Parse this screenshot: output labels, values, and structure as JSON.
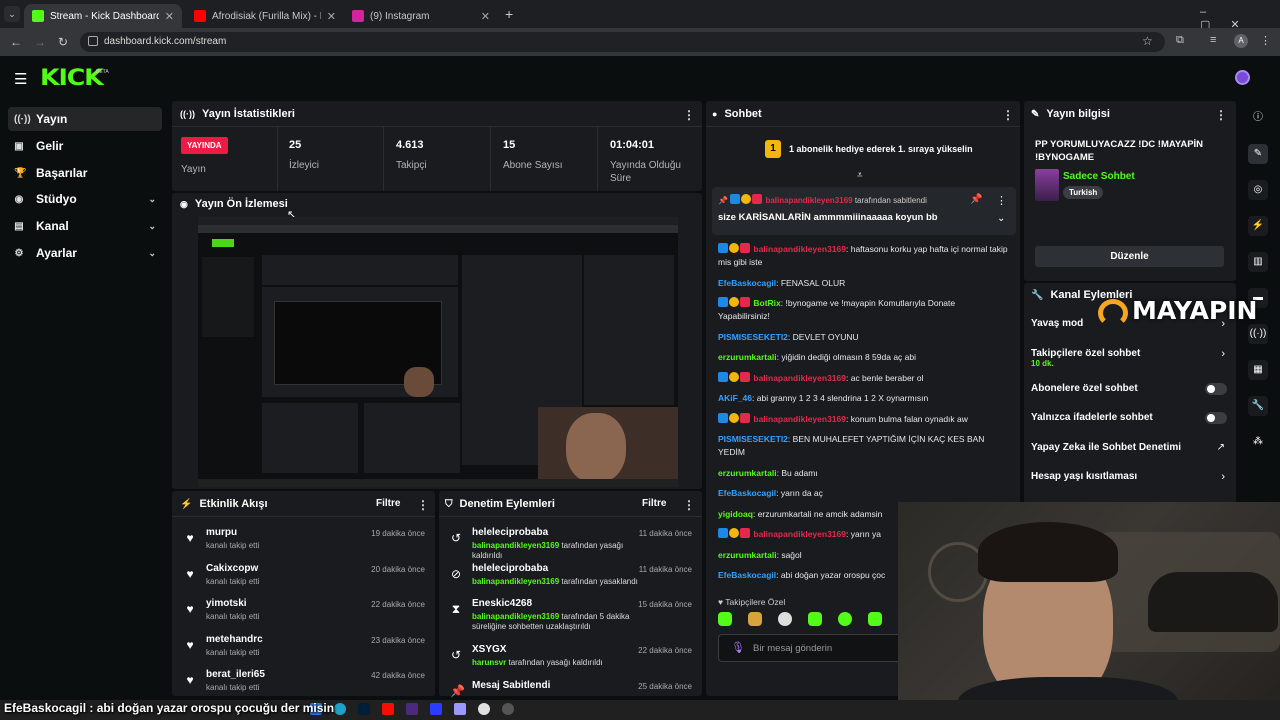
{
  "browser": {
    "tabs": [
      {
        "title": "Stream - Kick Dashboard",
        "color": "#53fc18"
      },
      {
        "title": "Afrodisiak (Furilla Mix) - Furilla...",
        "color": "#ff0000"
      },
      {
        "title": "(9) Instagram",
        "color": "#d6249f"
      }
    ],
    "url": "dashboard.kick.com/stream"
  },
  "brand": {
    "logo": "KICK",
    "beta": "BETA"
  },
  "sidebar": {
    "items": [
      {
        "label": "Yayın",
        "icon": "broadcast-icon"
      },
      {
        "label": "Gelir",
        "icon": "revenue-icon"
      },
      {
        "label": "Başarılar",
        "icon": "trophy-icon"
      },
      {
        "label": "Stüdyo",
        "icon": "studio-icon"
      },
      {
        "label": "Kanal",
        "icon": "channel-icon"
      },
      {
        "label": "Ayarlar",
        "icon": "gear-icon"
      }
    ]
  },
  "stats": {
    "title": "Yayın İstatistikleri",
    "live_badge": "YAYINDA",
    "live_label": "Yayın",
    "items": [
      {
        "value": "25",
        "label": "İzleyici"
      },
      {
        "value": "4.613",
        "label": "Takipçi"
      },
      {
        "value": "15",
        "label": "Abone Sayısı"
      },
      {
        "value": "01:04:01",
        "label": "Yayında Olduğu Süre"
      }
    ]
  },
  "preview": {
    "title": "Yayın Ön İzlemesi"
  },
  "activity": {
    "title": "Etkinlik Akışı",
    "filter": "Filtre",
    "items": [
      {
        "user": "murpu",
        "action": "kanalı takip etti",
        "time": "19 dakika önce"
      },
      {
        "user": "Cakixcopw",
        "action": "kanalı takip etti",
        "time": "20 dakika önce"
      },
      {
        "user": "yimotski",
        "action": "kanalı takip etti",
        "time": "22 dakika önce"
      },
      {
        "user": "metehandrc",
        "action": "kanalı takip etti",
        "time": "23 dakika önce"
      },
      {
        "user": "berat_ileri65",
        "action": "kanalı takip etti",
        "time": "42 dakika önce"
      }
    ]
  },
  "moderation": {
    "title": "Denetim Eylemleri",
    "filter": "Filtre",
    "items": [
      {
        "user": "heleleciprobaba",
        "mod": "balinapandikleyen3169",
        "action": "tarafından yasağı kaldırıldı",
        "time": "11 dakika önce",
        "icon": "undo-icon"
      },
      {
        "user": "heleleciprobaba",
        "mod": "balinapandikleyen3169",
        "action": "tarafından yasaklandı",
        "time": "11 dakika önce",
        "icon": "ban-icon"
      },
      {
        "user": "Eneskic4268",
        "mod": "balinapandikleyen3169",
        "action": "tarafından 5 dakika süreliğine sohbetten uzaklaştırıldı",
        "time": "15 dakika önce",
        "icon": "hourglass-icon"
      },
      {
        "user": "XSYGX",
        "mod": "harunsvr",
        "action": "tarafından yasağı kaldırıldı",
        "time": "22 dakika önce",
        "icon": "undo-icon"
      },
      {
        "user": "Mesaj Sabitlendi",
        "mod": "",
        "action": "",
        "time": "25 dakika önce",
        "icon": "pin-icon"
      }
    ]
  },
  "chat": {
    "title": "Sohbet",
    "gift_banner": "1 abonelik hediye ederek 1. sıraya yükselin",
    "gift_rank": "1",
    "pinned_by": "balinapandikleyen3169",
    "pinned_suffix": "tarafından sabitlendi",
    "pinned_text": "size KARİSANLARİN ammmmiiinaaaaa koyun bb",
    "messages": [
      {
        "user": "balinapandikleyen3169",
        "color": "#e5294c",
        "text": "haftasonu korku yap hafta içi normal takip mis gibi iste",
        "badges": true
      },
      {
        "user": "EfeBaskocagil",
        "color": "#35a1ff",
        "text": "FENASAL OLUR",
        "badges": false
      },
      {
        "user": "BotRix",
        "color": "#53fc18",
        "text": "!bynogame ve !mayapin Komutlarıyla Donate Yapabilirsiniz!",
        "badges": true
      },
      {
        "user": "PISMISESEKETI2",
        "color": "#35a1ff",
        "text": "DEVLET OYUNU",
        "badges": false
      },
      {
        "user": "erzurumkartali",
        "color": "#53fc18",
        "text": "yiğidin dediği olmasın 8 59da aç abi",
        "badges": false
      },
      {
        "user": "balinapandikleyen3169",
        "color": "#e5294c",
        "text": "ac benle beraber ol",
        "badges": true
      },
      {
        "user": "AKiF_46",
        "color": "#35a1ff",
        "text": "abi granny 1 2 3 4 slendrina 1 2 X oynarmısın",
        "badges": false
      },
      {
        "user": "balinapandikleyen3169",
        "color": "#e5294c",
        "text": "konum bulma falan oynadık aw",
        "badges": true
      },
      {
        "user": "PISMISESEKETI2",
        "color": "#35a1ff",
        "text": "BEN MUHALEFET YAPTIĞIM İÇİN KAÇ KES BAN YEDİM",
        "badges": false
      },
      {
        "user": "erzurumkartali",
        "color": "#53fc18",
        "text": "Bu adamı",
        "badges": false
      },
      {
        "user": "EfeBaskocagil",
        "color": "#35a1ff",
        "text": "yarın da aç",
        "badges": false
      },
      {
        "user": "yigidoaq",
        "color": "#53fc18",
        "text": "erzurumkartali ne amcik adamsin",
        "badges": false
      },
      {
        "user": "balinapandikleyen3169",
        "color": "#e5294c",
        "text": "yarın ya",
        "badges": true
      },
      {
        "user": "erzurumkartali",
        "color": "#53fc18",
        "text": "sağol",
        "badges": false
      },
      {
        "user": "EfeBaskocagil",
        "color": "#35a1ff",
        "text": "abi doğan yazar orospu çoc",
        "badges": false
      }
    ],
    "followers_only": "Takipçilere Özel",
    "input_placeholder": "Bir mesaj gönderin"
  },
  "stream_info": {
    "title": "Yayın bilgisi",
    "stream_title": "PP YORUMLUYACAZZ !DC !MAYAPİN !BYNOGAME",
    "category": "Sadece Sohbet",
    "tag": "Turkish",
    "edit": "Düzenle"
  },
  "channel_actions": {
    "title": "Kanal Eylemleri",
    "items": [
      {
        "label": "Yavaş mod",
        "sub": "",
        "type": "arrow"
      },
      {
        "label": "Takipçilere özel sohbet",
        "sub": "10 dk.",
        "type": "arrow"
      },
      {
        "label": "Abonelere özel sohbet",
        "sub": "",
        "type": "toggle"
      },
      {
        "label": "Yalnızca ifadelerle sohbet",
        "sub": "",
        "type": "toggle"
      },
      {
        "label": "Yapay Zeka ile Sohbet Denetimi",
        "sub": "",
        "type": "external"
      },
      {
        "label": "Hesap yaşı kısıtlaması",
        "sub": "",
        "type": "arrow"
      }
    ]
  },
  "overlay": {
    "sponsor": "MAYAPIN",
    "ticker_user": "EfeBaskocagil",
    "ticker_text": "abi doğan yazar orospu çocuğu der misin"
  },
  "colors": {
    "brand": "#53fc18",
    "live": "#ec1b45",
    "panel": "#191b1f",
    "bg": "#0b0e0f"
  }
}
